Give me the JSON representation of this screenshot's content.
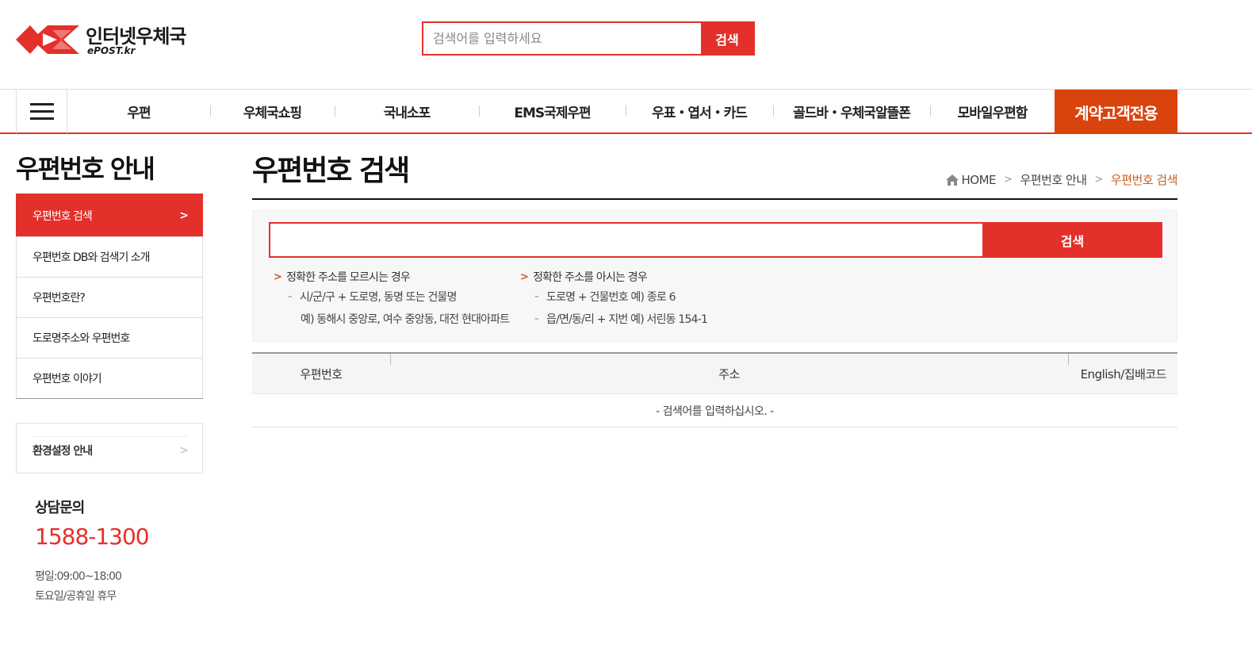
{
  "header": {
    "logo_title": "인터넷우체국",
    "logo_sub": "ePOST.kr",
    "search_placeholder": "검색어를 입력하세요",
    "search_button": "검색"
  },
  "gnb": {
    "items": [
      "우편",
      "우체국쇼핑",
      "국내소포",
      "EMS국제우편",
      "우표・엽서・카드",
      "골드바・우체국알뜰폰",
      "모바일우편함"
    ],
    "contract": "계약고객전용"
  },
  "sidebar": {
    "title": "우편번호 안내",
    "items": [
      {
        "label": "우편번호 검색",
        "active": true
      },
      {
        "label": "우편번호 DB와 검색기 소개",
        "active": false
      },
      {
        "label": "우편번호란?",
        "active": false
      },
      {
        "label": "도로명주소와 우편번호",
        "active": false
      },
      {
        "label": "우편번호 이야기",
        "active": false
      }
    ],
    "env_label": "환경설정 안내",
    "cs_title": "상담문의",
    "cs_phone": "1588-1300",
    "cs_time_weekday": "평일:09:00~18:00",
    "cs_time_weekend": "토요일/공휴일 휴무"
  },
  "main": {
    "title": "우편번호 검색",
    "breadcrumb": [
      "HOME",
      "우편번호 안내",
      "우편번호 검색"
    ],
    "search_value": "",
    "search_button": "검색",
    "tips_unknown": {
      "head": "정확한 주소를 모르시는 경우",
      "line1": "시/군/구 + 도로명, 동명 또는 건물명",
      "line2": "예) 동해시 중앙로, 여수 중앙동, 대전 현대아파트"
    },
    "tips_known": {
      "head": "정확한 주소를 아시는 경우",
      "line1": "도로명 + 건물번호 예) 종로 6",
      "line2": "읍/면/동/리 + 지번 예) 서린동 154-1"
    },
    "table": {
      "headers": [
        "우편번호",
        "주소",
        "English/집배코드"
      ],
      "empty_message": "- 검색어를 입력하십시오. -"
    }
  },
  "colors": {
    "accent": "#e4302b",
    "contract": "#d9440d",
    "breadcrumb_current": "#c8601a"
  }
}
